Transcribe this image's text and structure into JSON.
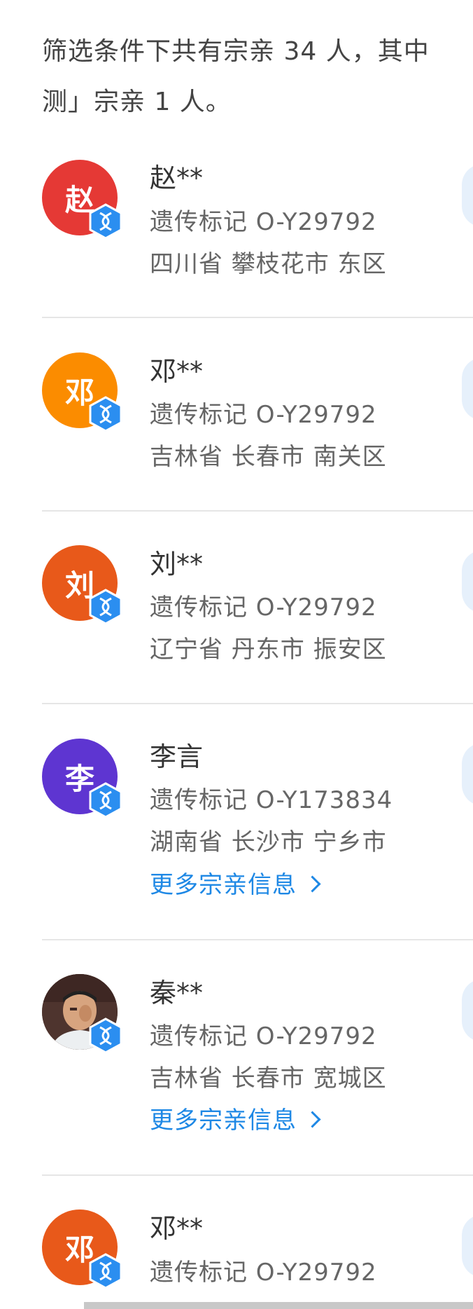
{
  "summary": {
    "line1": "筛选条件下共有宗亲 34 人，其中",
    "line2": "测」宗亲 1 人。"
  },
  "relatives": [
    {
      "avatar_char": "赵",
      "avatar_color": "#e53935",
      "name": "赵**",
      "marker": "遗传标记 O-Y29792",
      "location": "四川省 攀枝花市 东区",
      "more_link": null
    },
    {
      "avatar_char": "邓",
      "avatar_color": "#fb8c00",
      "name": "邓**",
      "marker": "遗传标记 O-Y29792",
      "location": "吉林省 长春市 南关区",
      "more_link": null
    },
    {
      "avatar_char": "刘",
      "avatar_color": "#e8591a",
      "name": "刘**",
      "marker": "遗传标记 O-Y29792",
      "location": "辽宁省 丹东市 振安区",
      "more_link": null
    },
    {
      "avatar_char": "李",
      "avatar_color": "#5e35d1",
      "name": "李言",
      "marker": "遗传标记 O-Y173834",
      "location": "湖南省 长沙市 宁乡市",
      "more_link": "更多宗亲信息"
    },
    {
      "avatar_char": "",
      "avatar_color": "#6d4c41",
      "avatar_is_photo": true,
      "name": "秦**",
      "marker": "遗传标记 O-Y29792",
      "location": "吉林省 长春市 宽城区",
      "more_link": "更多宗亲信息"
    },
    {
      "avatar_char": "邓",
      "avatar_color": "#e8591a",
      "name": "邓**",
      "marker": "遗传标记 O-Y29792",
      "location": "",
      "more_link": null
    }
  ],
  "colors": {
    "badge": "#2b8ef0",
    "link": "#1e88e5",
    "side_button": "#e6f0fb"
  },
  "icons": {
    "badge": "dna-hexagon-icon",
    "more_link": "chevron-right-icon"
  }
}
